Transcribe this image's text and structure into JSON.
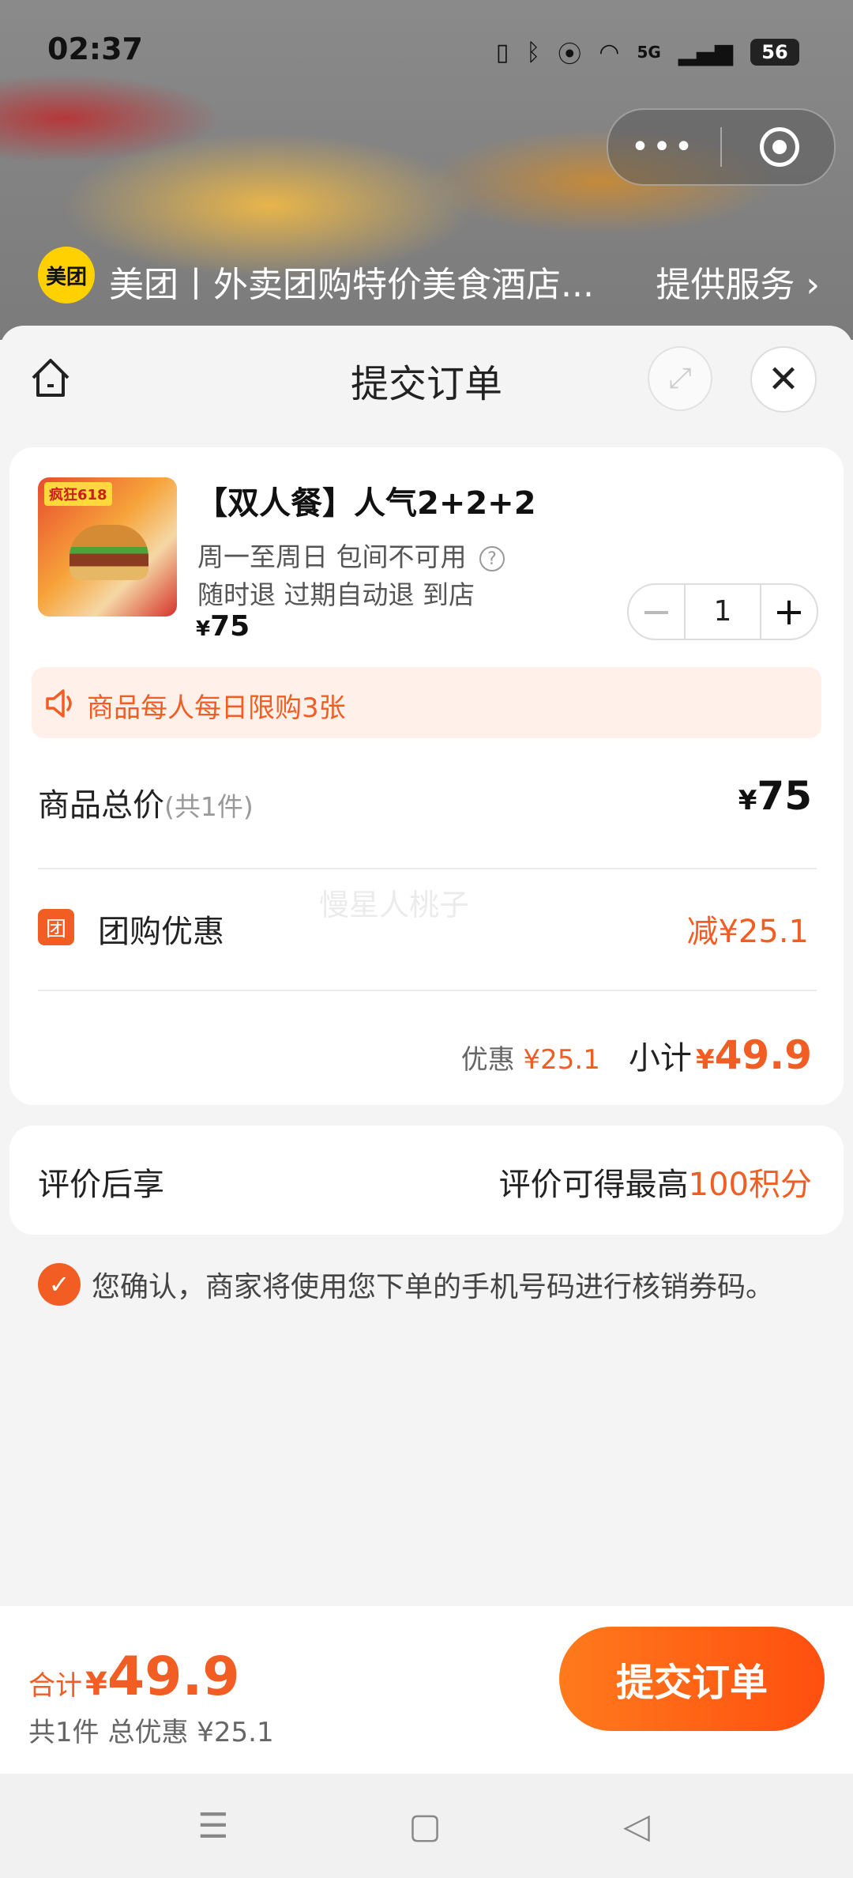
{
  "status_bar": {
    "time": "02:37",
    "network": "5G",
    "battery": "56"
  },
  "mini_program": {
    "logo": "美团",
    "title": "美团丨外卖团购特价美食酒店...",
    "service": "提供服务",
    "capsule_more": "•••"
  },
  "nav": {
    "title": "提交订单"
  },
  "product": {
    "image_tag": "疯狂618",
    "name": "【双人餐】人气2+2+2",
    "line1": "周一至周日 包间不可用",
    "line2": "随时退 过期自动退 到店",
    "price_symbol": "¥",
    "price": "75",
    "quantity": "1",
    "limit_notice": "商品每人每日限购3张"
  },
  "summary": {
    "total_label": "商品总价",
    "total_count": "(共1件)",
    "total_symbol": "¥",
    "total_value": "75",
    "promo_icon": "团",
    "promo_label": "团购优惠",
    "promo_value": "减¥25.1",
    "watermark": "慢星人桃子",
    "discount_label": "优惠",
    "discount_value": "¥25.1",
    "subtotal_label": "小计",
    "subtotal_symbol": "¥",
    "subtotal_value": "49.9"
  },
  "review": {
    "left": "评价后享",
    "right_prefix": "评价可得最高",
    "right_highlight": "100积分"
  },
  "confirm_text": "您确认，商家将使用您下单的手机号码进行核销券码。",
  "bottom": {
    "sum_label": "合计",
    "sum_symbol": "¥",
    "sum_value": "49.9",
    "sum_sub": "共1件 总优惠 ¥25.1",
    "submit_label": "提交订单"
  },
  "colors": {
    "accent": "#f25d24",
    "button_gradient_start": "#ff7a1c",
    "button_gradient_end": "#ff4f0f",
    "logo_yellow": "#ffd100"
  }
}
